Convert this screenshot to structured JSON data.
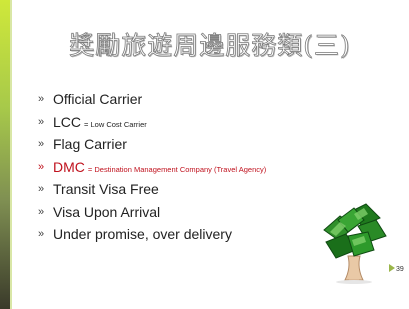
{
  "slide": {
    "title": "獎勵旅遊周邊服務類(三)",
    "bullet_marker": "»",
    "bullets": [
      {
        "text": "Official Carrier",
        "note": ""
      },
      {
        "text": "LCC",
        "note": "= Low Cost Carrier"
      },
      {
        "text": "Flag Carrier",
        "note": ""
      },
      {
        "text": "DMC",
        "note": "= Destination Management Company (Travel Agency)"
      },
      {
        "text": "Transit Visa Free",
        "note": ""
      },
      {
        "text": "Visa Upon Arrival",
        "note": ""
      },
      {
        "text": "Under promise, over delivery",
        "note": ""
      }
    ],
    "page_number": "39",
    "colors": {
      "highlight": "#c0121e",
      "text": "#222222",
      "accent_bar": "#a7c94a"
    },
    "icons": {
      "bullet": "chevron-double-right-icon",
      "picture": "tree-clipart",
      "page_marker": "triangle-right-icon"
    }
  }
}
